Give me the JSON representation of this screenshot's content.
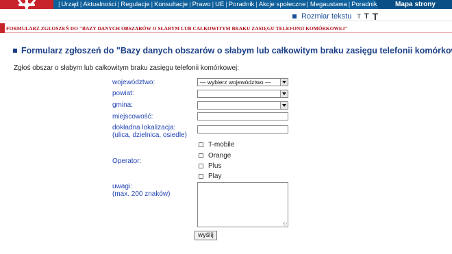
{
  "nav": {
    "items": [
      "Urząd",
      "Aktualności",
      "Regulacje",
      "Konsultacje",
      "Prawo",
      "UE",
      "Poradnik",
      "Akcje społeczne",
      "Megaustawa",
      "Poradnik dla jst"
    ],
    "map_link": "Mapa strony"
  },
  "text_size": {
    "label": "Rozmiar tekstu",
    "small": "T",
    "medium": "T",
    "large": "T"
  },
  "breadcrumb": "FORMULARZ ZGŁOSZEŃ DO \"BAZY DANYCH OBSZARÓW O SŁABYM LUB CAŁKOWITYM BRAKU ZASIĘGU TELEFONII KOMÓRKOWEJ\"",
  "page": {
    "heading": "Formularz zgłoszeń do \"Bazy danych obszarów o słabym lub całkowitym braku zasięgu telefonii komórkowej\"",
    "intro": "Zgłoś obszar o słabym lub całkowitym braku zasięgu telefonii komórkowej:"
  },
  "form": {
    "wojewodztwo_label": "województwo:",
    "wojewodztwo_value": "— wybierz województwo —",
    "powiat_label": "powiat:",
    "powiat_value": "",
    "gmina_label": "gmina:",
    "gmina_value": "",
    "miejscowosc_label": "miejscowość:",
    "lokalizacja_label_1": "dokładna lokalizacja:",
    "lokalizacja_label_2": "(ulica, dzielnica, osiedle)",
    "operator_label": "Operator:",
    "operators": [
      "T-mobile",
      "Orange",
      "Plus",
      "Play"
    ],
    "uwagi_label_1": "uwagi:",
    "uwagi_label_2": "(max. 200 znaków)",
    "submit": "wyślij"
  },
  "colors": {
    "nav_bg": "#0f5f9a",
    "logo_red": "#c8242b",
    "label_blue": "#2345b5",
    "heading_blue": "#1b3f86",
    "breadcrumb_red": "#b00f1a"
  }
}
